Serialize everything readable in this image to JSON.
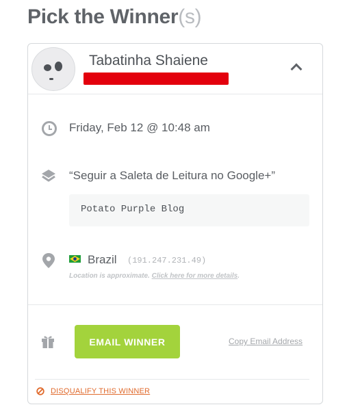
{
  "header": {
    "title_main": "Pick the Winner",
    "title_suffix": "(s)"
  },
  "winner": {
    "name": "Tabatinha Shaiene",
    "datetime": "Friday, Feb 12 @ 10:48 am",
    "entry_action": "“Seguir a Saleta de Leitura no Google+”",
    "entry_value": "Potato Purple Blog",
    "country": "Brazil",
    "ip": "(191.247.231.49)",
    "location_note": "Location is approximate.",
    "location_link": "Click here for more details"
  },
  "actions": {
    "email_button": "EMAIL WINNER",
    "copy_email": "Copy Email Address",
    "disqualify": "DISQUALIFY THIS WINNER"
  },
  "icons": {
    "collapse": "chevron-up-icon",
    "time": "clock-icon",
    "entry": "layers-icon",
    "location": "map-pin-icon",
    "flag": "brazil-flag-icon",
    "prize": "gift-icon",
    "disqualify": "ban-icon"
  },
  "colors": {
    "accent_green": "#a3d33c",
    "danger_orange": "#e06a2c",
    "redaction": "#e3000d"
  }
}
